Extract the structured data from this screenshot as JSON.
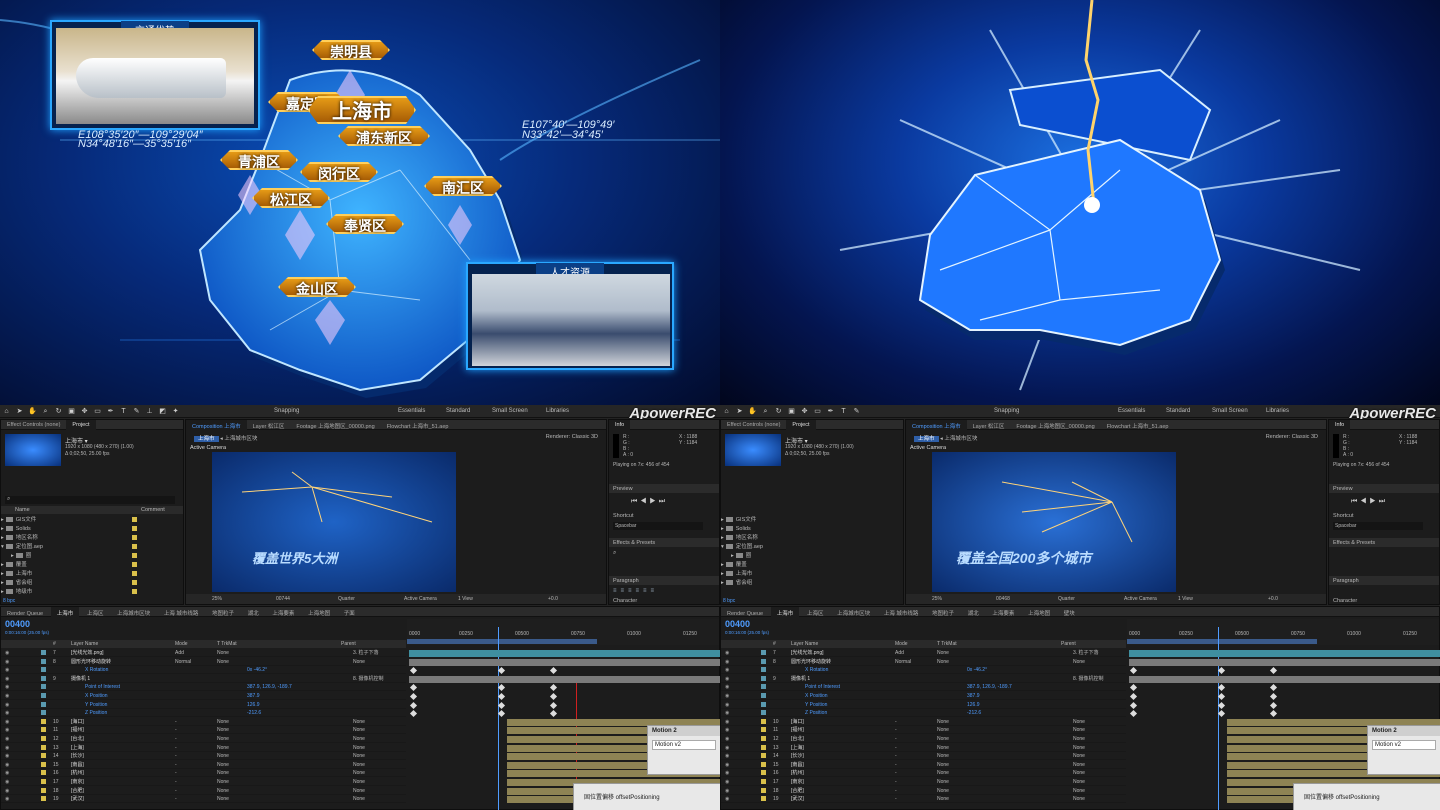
{
  "top_left": {
    "panel_traffic_title": "交通优势",
    "coord_left_1": "E108°35′20″—109°29′04″",
    "coord_left_2": "N34°48′16″—35°35′16″",
    "coord_right_1": "E107°40′—109°49′",
    "coord_right_2": "N33°42′—34°45′",
    "panel_talent_title": "人才资源",
    "labels": [
      "崇明县",
      "嘉定区",
      "上海市",
      "浦东新区",
      "青浦区",
      "闵行区",
      "南汇区",
      "松江区",
      "奉贤区",
      "金山区"
    ]
  },
  "ae": {
    "workspaces": [
      "Snapping",
      "Essentials",
      "Standard",
      "Small Screen",
      "Libraries"
    ],
    "watermark": "ApowerREC",
    "tabs_left": [
      "Effect Controls (none)",
      "Project"
    ],
    "comp_tabs": [
      "Composition 上海市",
      "Layer 松江区",
      "Footage 上海地图区_00000.png",
      "Flowchart 上海市_51.aep"
    ],
    "breadcrumb": [
      "上海市",
      "上海城市区块"
    ],
    "renderer_label": "Renderer:",
    "renderer_value": "Classic 3D",
    "active_camera": "Active Camera",
    "project_item": "上海市 ▾",
    "project_info_1": "1920 x 1080 (480 x 270) (1.00)",
    "project_info_2": "Δ 0;02;50, 25.00 fps",
    "project_cols": [
      "Name",
      "Comment"
    ],
    "project_rows": [
      "GIS文件",
      "Solids",
      "地区名称",
      "定位图.aep",
      "圈",
      "覆盖",
      "上海市",
      "省会组",
      "地级市"
    ],
    "bpc": "8 bpc",
    "viewer_bottom": [
      "25%",
      "Quarter",
      "Active Camera",
      "1 View",
      "+0.0"
    ],
    "info_panel": {
      "title": "Info",
      "r": "R :",
      "g": "G :",
      "b": "B :",
      "a": "A : 0",
      "x": "X : 1188",
      "y": "Y : 1184",
      "playing": "Playing on 7x: 456 of 454"
    },
    "preview_title": "Preview",
    "shortcut_title": "Shortcut",
    "shortcut_value": "Spacebar",
    "effects_title": "Effects & Presets",
    "paragraph_title": "Paragraph",
    "character_title": "Character",
    "timeline_tabs": [
      "Render Queue",
      "上海市",
      "上海区",
      "上海城市区块",
      "上海 城市线路",
      "地图粒子",
      "湖北",
      "上海要素",
      "上海地图",
      "子面",
      "壁块"
    ],
    "timecode_left": "00400",
    "timecode_right": "00400",
    "timecode_sub": "0:00:16:00 (25.00 fps)",
    "left_viewer_frame": "00744",
    "right_viewer_frame": "00468",
    "viewer_caption_left": "覆盖世界5大洲",
    "viewer_caption_right": "覆盖全国200多个城市",
    "ruler": [
      "0000",
      "00250",
      "00500",
      "00750",
      "01000",
      "01250"
    ],
    "layer_header": [
      "#",
      "Layer Name",
      "Mode",
      "T TrkMat",
      "Parent"
    ],
    "layers": [
      {
        "n": "7",
        "name": "[光线光效.png]",
        "mode": "Add",
        "trk": "None",
        "parent": "3. 粒子下落"
      },
      {
        "n": "8",
        "name": "圆形光环移动旋转",
        "mode": "Normal",
        "trk": "None",
        "parent": "None"
      },
      {
        "n": "",
        "name": "X Rotation",
        "mode": "",
        "trk": "",
        "parent": "0x -46.2°"
      },
      {
        "n": "9",
        "name": "摄像机 1",
        "mode": "",
        "trk": "",
        "parent": "8. 摄像机控制"
      },
      {
        "n": "",
        "name": "Point of Interest",
        "mode": "",
        "trk": "",
        "parent": "387.9, 126.9, -189.7"
      },
      {
        "n": "",
        "name": "X Position",
        "mode": "",
        "trk": "",
        "parent": "387.9"
      },
      {
        "n": "",
        "name": "Y Position",
        "mode": "",
        "trk": "",
        "parent": "126.9"
      },
      {
        "n": "",
        "name": "Z Position",
        "mode": "",
        "trk": "",
        "parent": "-212.6"
      },
      {
        "n": "10",
        "name": "[海口]",
        "mode": "-",
        "trk": "None",
        "parent": "None"
      },
      {
        "n": "11",
        "name": "[福州]",
        "mode": "-",
        "trk": "None",
        "parent": "None"
      },
      {
        "n": "12",
        "name": "[台北]",
        "mode": "-",
        "trk": "None",
        "parent": "None"
      },
      {
        "n": "13",
        "name": "[上海]",
        "mode": "-",
        "trk": "None",
        "parent": "None"
      },
      {
        "n": "14",
        "name": "[长沙]",
        "mode": "-",
        "trk": "None",
        "parent": "None"
      },
      {
        "n": "15",
        "name": "[南昌]",
        "mode": "-",
        "trk": "None",
        "parent": "None"
      },
      {
        "n": "16",
        "name": "[杭州]",
        "mode": "-",
        "trk": "None",
        "parent": "None"
      },
      {
        "n": "17",
        "name": "[南京]",
        "mode": "-",
        "trk": "None",
        "parent": "None"
      },
      {
        "n": "18",
        "name": "[合肥]",
        "mode": "-",
        "trk": "None",
        "parent": "None"
      },
      {
        "n": "19",
        "name": "[武汉]",
        "mode": "-",
        "trk": "None",
        "parent": "None"
      }
    ],
    "motion_popup_title": "Motion 2",
    "motion_popup_field": "Motion v2",
    "offset_popup": "固位置偏移 offsetPositioning"
  }
}
